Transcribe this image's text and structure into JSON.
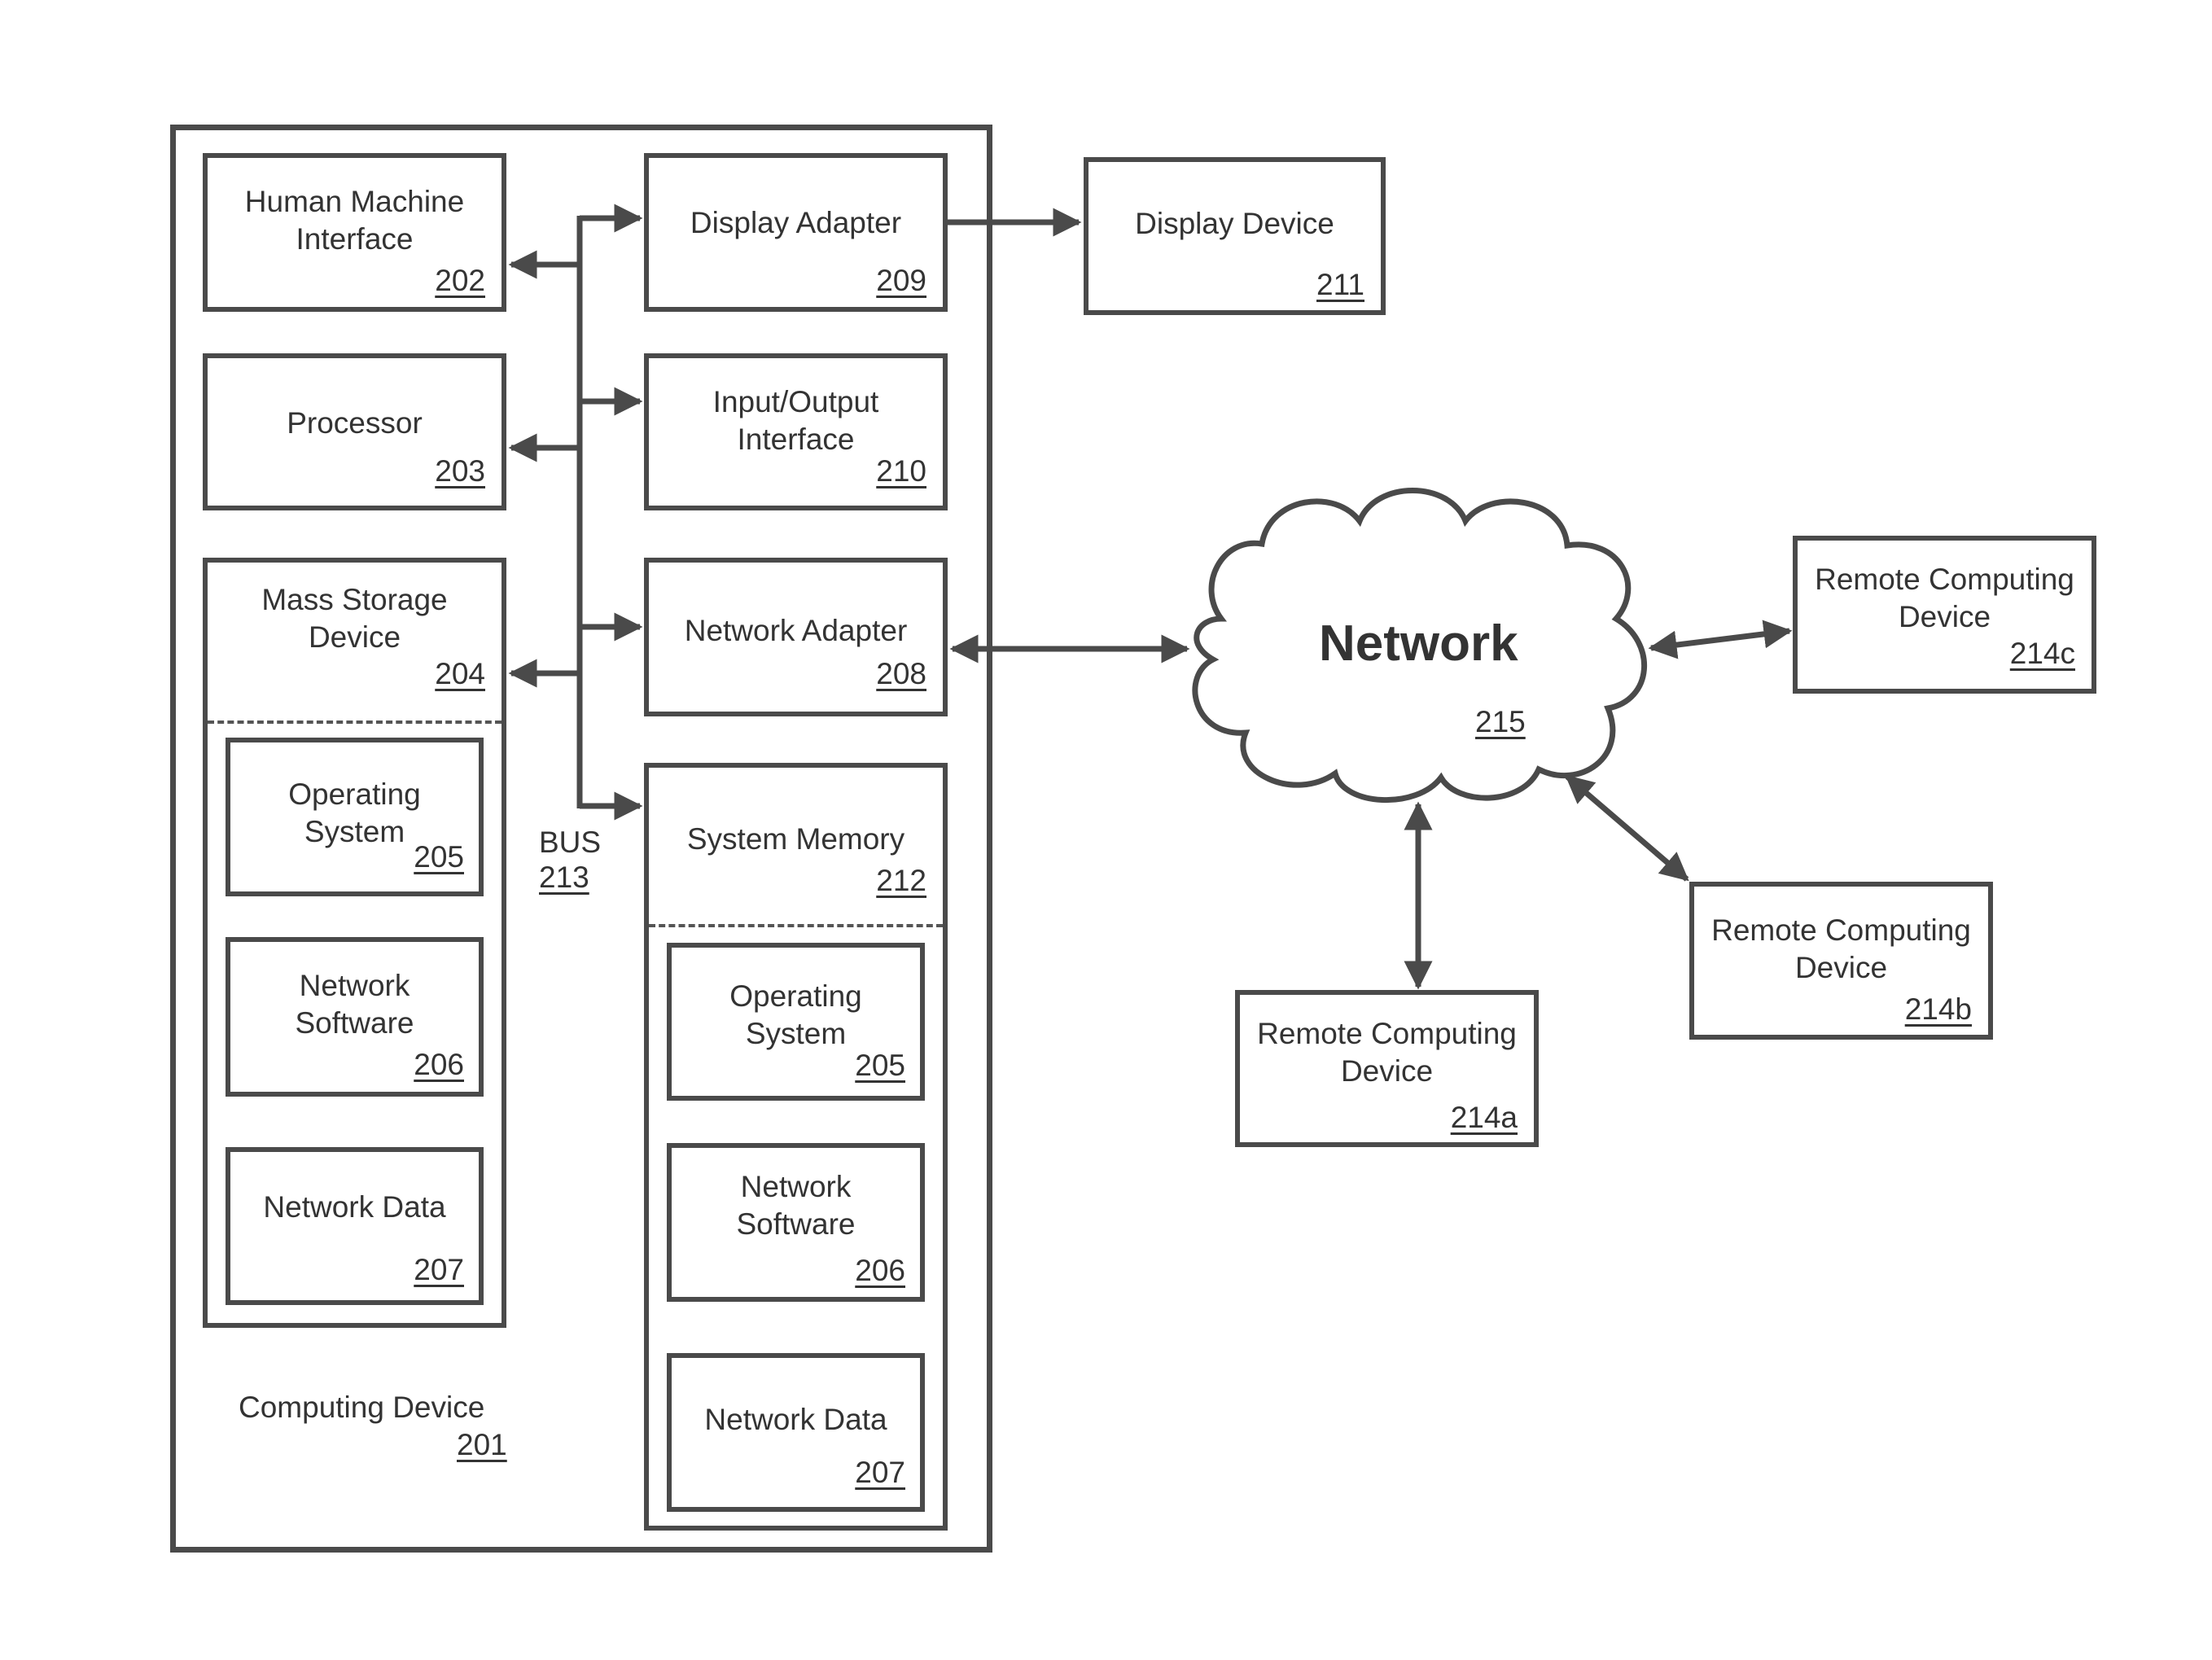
{
  "computing_device": {
    "label": "Computing Device",
    "ref": "201"
  },
  "bus": {
    "label": "BUS",
    "ref": "213"
  },
  "hmi": {
    "label_line1": "Human Machine",
    "label_line2": "Interface",
    "ref": "202"
  },
  "processor": {
    "label": "Processor",
    "ref": "203"
  },
  "mass_storage": {
    "label_line1": "Mass Storage",
    "label_line2": "Device",
    "ref": "204",
    "children": [
      {
        "line1": "Operating",
        "line2": "System",
        "ref": "205"
      },
      {
        "line1": "Network",
        "line2": "Software",
        "ref": "206"
      },
      {
        "line1": "Network Data",
        "line2": "",
        "ref": "207"
      }
    ]
  },
  "display_adapter": {
    "label": "Display Adapter",
    "ref": "209"
  },
  "io_interface": {
    "label_line1": "Input/Output",
    "label_line2": "Interface",
    "ref": "210"
  },
  "network_adapter": {
    "label": "Network Adapter",
    "ref": "208"
  },
  "system_memory": {
    "label": "System Memory",
    "ref": "212",
    "children": [
      {
        "line1": "Operating",
        "line2": "System",
        "ref": "205"
      },
      {
        "line1": "Network",
        "line2": "Software",
        "ref": "206"
      },
      {
        "line1": "Network Data",
        "line2": "",
        "ref": "207"
      }
    ]
  },
  "display_device": {
    "label": "Display Device",
    "ref": "211"
  },
  "network": {
    "label": "Network",
    "ref": "215"
  },
  "remote_a": {
    "line1": "Remote Computing",
    "line2": "Device",
    "ref": "214a"
  },
  "remote_b": {
    "line1": "Remote Computing",
    "line2": "Device",
    "ref": "214b"
  },
  "remote_c": {
    "line1": "Remote Computing",
    "line2": "Device",
    "ref": "214c"
  }
}
